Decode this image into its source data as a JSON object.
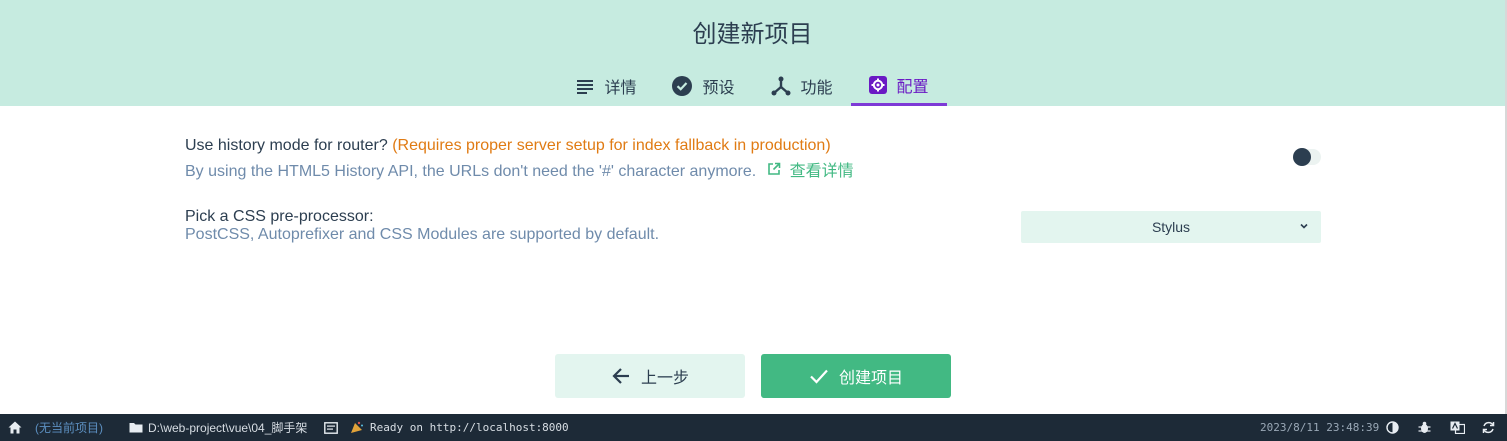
{
  "header": {
    "title": "创建新项目",
    "tabs": [
      {
        "label": "详情",
        "icon": "list-icon",
        "active": false
      },
      {
        "label": "预设",
        "icon": "check-circle-icon",
        "active": false
      },
      {
        "label": "功能",
        "icon": "fork-icon",
        "active": false
      },
      {
        "label": "配置",
        "icon": "settings-icon",
        "active": true
      }
    ]
  },
  "settings": {
    "router": {
      "label": "Use history mode for router?",
      "warning": "(Requires proper server setup for index fallback in production)",
      "description": "By using the HTML5 History API, the URLs don't need the '#' character anymore.",
      "link_label": "查看详情",
      "enabled": false
    },
    "css": {
      "label": "Pick a CSS pre-processor:",
      "description": "PostCSS, Autoprefixer and CSS Modules are supported by default.",
      "selected": "Stylus"
    }
  },
  "actions": {
    "prev_label": "上一步",
    "create_label": "创建项目"
  },
  "statusbar": {
    "no_project": "(无当前项目)",
    "path": "D:\\web-project\\vue\\04_脚手架",
    "log": "Ready on http://localhost:8000",
    "datetime": "2023/8/11 23:48:39"
  },
  "colors": {
    "accent": "#42b983",
    "header_bg": "#c6ebe0",
    "active_tab": "#6a1ac4",
    "warning": "#e07b14",
    "statusbar_bg": "#1d2a37"
  }
}
